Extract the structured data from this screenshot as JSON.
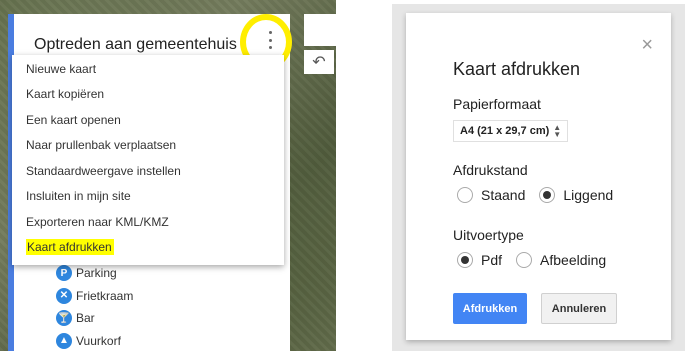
{
  "map": {
    "title": "Optreden aan gemeentehuis",
    "layers": [
      {
        "icon": "parking-icon",
        "glyph": "P",
        "label": "Parking"
      },
      {
        "icon": "close-circle-icon",
        "glyph": "✕",
        "label": "Frietkraam"
      },
      {
        "icon": "cocktail-icon",
        "glyph": "🍸",
        "label": "Bar"
      },
      {
        "icon": "fire-icon",
        "glyph": "▲",
        "label": "Vuurkorf"
      }
    ]
  },
  "menu": {
    "items": [
      {
        "label": "Nieuwe kaart"
      },
      {
        "label": "Kaart kopiëren"
      },
      {
        "label": "Een kaart openen"
      },
      {
        "label": "Naar prullenbak verplaatsen"
      },
      {
        "label": "Standaardweergave instellen"
      },
      {
        "label": "Insluiten in mijn site"
      },
      {
        "label": "Exporteren naar KML/KMZ"
      },
      {
        "label": "Kaart afdrukken"
      }
    ]
  },
  "dialog": {
    "title": "Kaart afdrukken",
    "close_glyph": "×",
    "paper_size_label": "Papierformaat",
    "paper_size_value": "A4 (21 x 29,7 cm)",
    "orientation_label": "Afdrukstand",
    "orientation_options": [
      "Staand",
      "Liggend"
    ],
    "orientation_selected": "Liggend",
    "output_label": "Uitvoertype",
    "output_options": [
      "Pdf",
      "Afbeelding"
    ],
    "output_selected": "Pdf",
    "print_button": "Afdrukken",
    "cancel_button": "Annuleren"
  },
  "colors": {
    "highlight": "#ffff00",
    "annotation_circle": "#ffee00",
    "primary_button": "#4285f4",
    "layer_icon": "#2e86de"
  }
}
